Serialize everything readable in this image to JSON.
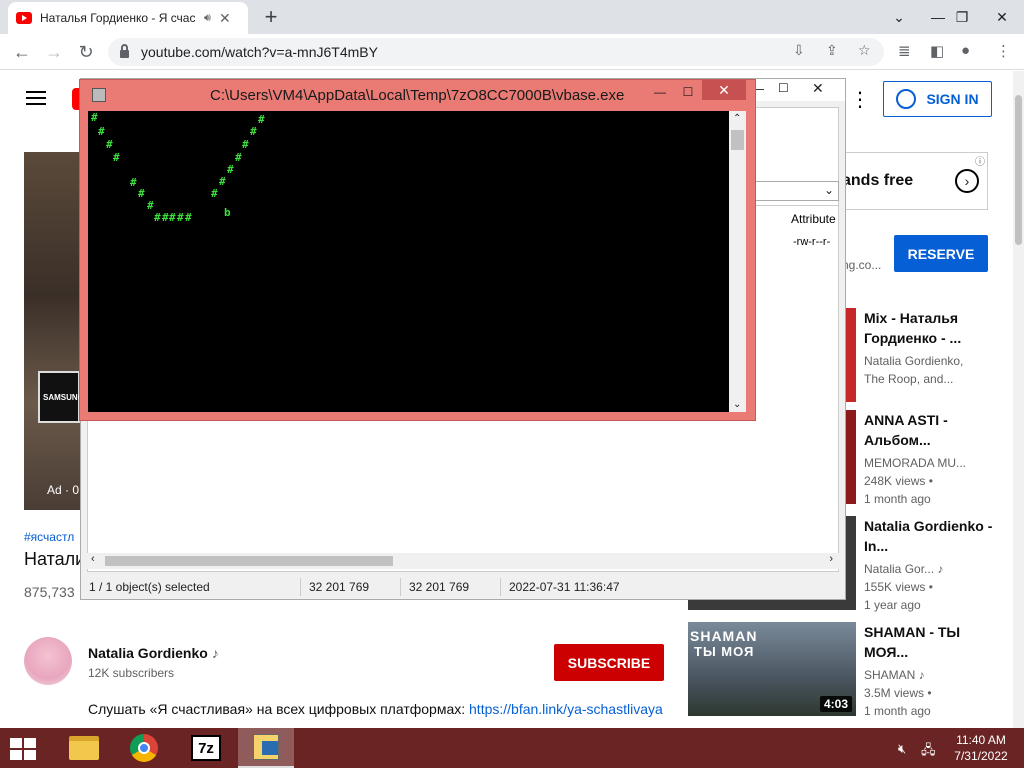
{
  "browser": {
    "tab_title": "Наталья Гордиенко - Я счас",
    "audio_icon": "speaker-icon",
    "url": "youtube.com/watch?v=a-mnJ6T4mBY"
  },
  "youtube": {
    "signin_label": "SIGN IN",
    "ad_label": "Ad · 0",
    "samsung_label": "SAMSUNG",
    "hashtag": "#ясчастл",
    "video_title": "Натали",
    "views": "875,733",
    "channel_name": "Natalia Gordienko",
    "music_note": "♪",
    "subscribers": "12K subscribers",
    "subscribe_label": "SUBSCRIBE",
    "description_text": "Слушать «Я счастливая» на всех цифровых платформах: ",
    "description_link": "https://bfan.link/ya-schastlivaya",
    "ad_card_text": "ands free",
    "ad_domain": "ng.co...",
    "reserve_label": "RESERVE"
  },
  "recommendations": [
    {
      "title": "Mix - Наталья Гордиенко - ...",
      "meta1": "Natalia Gordienko,",
      "meta2": "The Roop, and...",
      "meta3": "",
      "duration": ""
    },
    {
      "title": "ANNA ASTI - Альбом...",
      "meta1": "MEMORADA MU...",
      "meta2": "248K views •",
      "meta3": "1 month ago",
      "duration": ""
    },
    {
      "title": "Natalia Gordienko - In...",
      "meta1": "Natalia Gor... ♪",
      "meta2": "155K views •",
      "meta3": "1 year ago",
      "duration": ""
    },
    {
      "title": "SHAMAN - ТЫ МОЯ...",
      "meta1": "SHAMAN ♪",
      "meta2": "3.5M views •",
      "meta3": "1 month ago",
      "duration": "4:03",
      "thumb_text1": "SHAMAN",
      "thumb_text2": "ТЫ МОЯ"
    }
  ],
  "zip": {
    "column_attr": "Attribute",
    "row_attr": "-rw-r--r-",
    "status_selected": "1 / 1 object(s) selected",
    "status_size": "32 201 769",
    "status_packed": "32 201 769",
    "status_date": "2022-07-31 11:36:47"
  },
  "console": {
    "title": "C:\\Users\\VM4\\AppData\\Local\\Temp\\7zO8CC7000B\\vbase.exe",
    "glyph": "#",
    "food_char": "b"
  },
  "taskbar": {
    "time": "11:40 AM",
    "date": "7/31/2022",
    "seven_zip_label": "7z"
  }
}
